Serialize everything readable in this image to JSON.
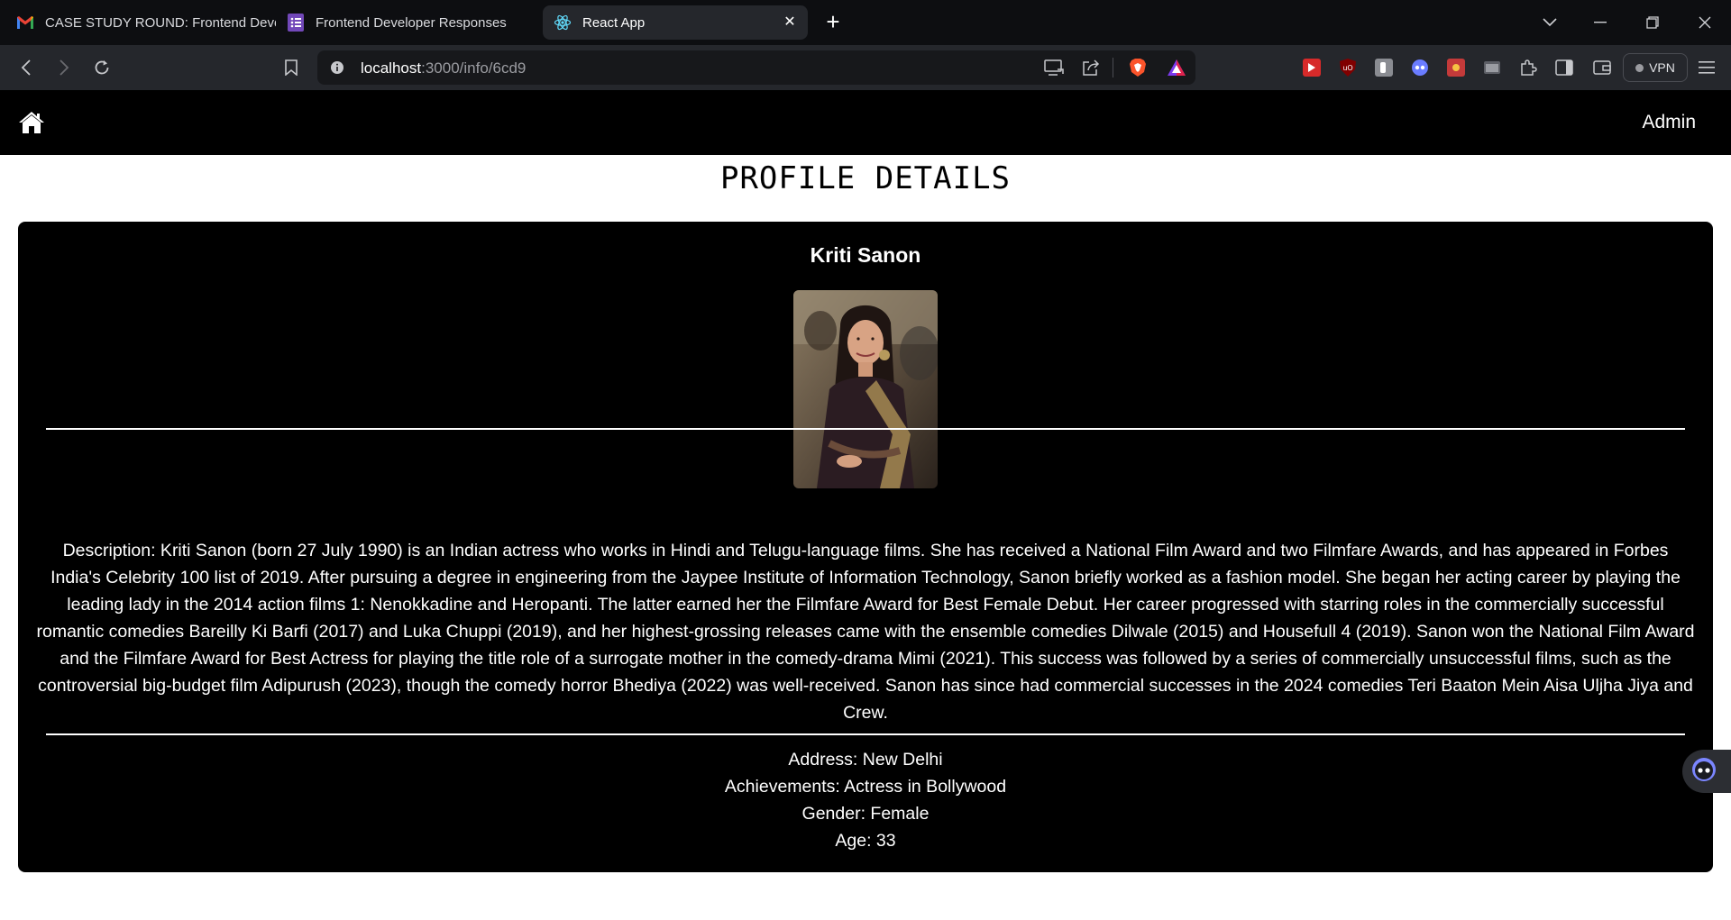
{
  "browser": {
    "tabs": [
      {
        "title": "CASE STUDY ROUND: Frontend Deve",
        "icon": "gmail-icon"
      },
      {
        "title": "Frontend Developer Responses",
        "icon": "forms-icon"
      },
      {
        "title": "React App",
        "icon": "react-icon",
        "active": true
      }
    ],
    "url_host": "localhost",
    "url_path": ":3000/info/6cd9",
    "vpn_label": "VPN"
  },
  "navbar": {
    "admin_label": "Admin"
  },
  "page": {
    "title": "PROFILE DETAILS"
  },
  "profile": {
    "name": "Kriti Sanon",
    "description": "Description: Kriti Sanon (born 27 July 1990) is an Indian actress who works in Hindi and Telugu-language films. She has received a National Film Award and two Filmfare Awards, and has appeared in Forbes India's Celebrity 100 list of 2019. After pursuing a degree in engineering from the Jaypee Institute of Information Technology, Sanon briefly worked as a fashion model. She began her acting career by playing the leading lady in the 2014 action films 1: Nenokkadine and Heropanti. The latter earned her the Filmfare Award for Best Female Debut. Her career progressed with starring roles in the commercially successful romantic comedies Bareilly Ki Barfi (2017) and Luka Chuppi (2019), and her highest-grossing releases came with the ensemble comedies Dilwale (2015) and Housefull 4 (2019). Sanon won the National Film Award and the Filmfare Award for Best Actress for playing the title role of a surrogate mother in the comedy-drama Mimi (2021). This success was followed by a series of commercially unsuccessful films, such as the controversial big-budget film Adipurush (2023), though the comedy horror Bhediya (2022) was well-received. Sanon has since had commercial successes in the 2024 comedies Teri Baaton Mein Aisa Uljha Jiya and Crew.",
    "address": "Address: New Delhi",
    "achievements": "Achievements: Actress in Bollywood",
    "gender": "Gender: Female",
    "age": "Age: 33"
  },
  "colors": {
    "navbar_bg": "#000000",
    "card_bg": "#000000",
    "tab_active_bg": "#25272c",
    "toolbar_bg": "#25272c"
  }
}
